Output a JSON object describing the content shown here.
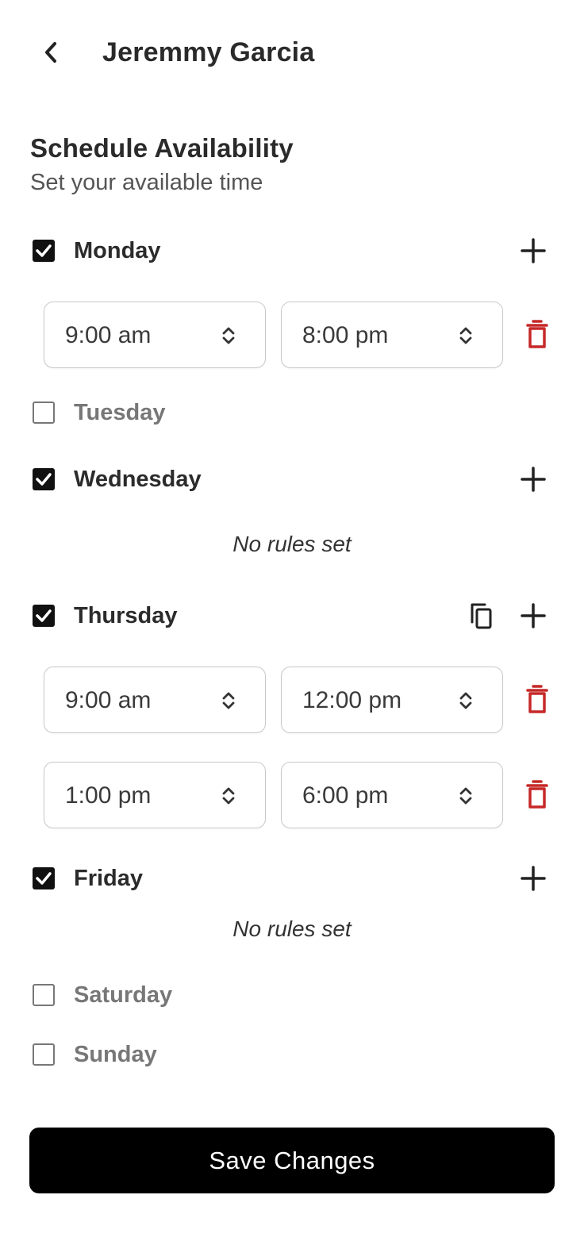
{
  "header": {
    "back_icon": "chevron-left-icon",
    "title": "Jeremmy Garcia"
  },
  "section": {
    "title": "Schedule Availability",
    "subtitle": "Set your available time"
  },
  "days": [
    {
      "label": "Monday",
      "checked": true,
      "slots": [
        {
          "start": "9:00 am",
          "end": "8:00 pm"
        }
      ]
    },
    {
      "label": "Tuesday",
      "checked": false,
      "slots": []
    },
    {
      "label": "Wednesday",
      "checked": true,
      "slots": [],
      "empty_text": "No rules set"
    },
    {
      "label": "Thursday",
      "checked": true,
      "slots": [
        {
          "start": "9:00 am",
          "end": "12:00 pm"
        },
        {
          "start": "1:00 pm",
          "end": "6:00 pm"
        }
      ]
    },
    {
      "label": "Friday",
      "checked": true,
      "slots": [],
      "empty_text": "No rules set"
    },
    {
      "label": "Saturday",
      "checked": false,
      "slots": []
    },
    {
      "label": "Sunday",
      "checked": false,
      "slots": []
    }
  ],
  "actions": {
    "save_label": "Save Changes"
  },
  "colors": {
    "accent": "#000000",
    "delete": "#c62828",
    "text": "#2b2b2b",
    "muted": "#777777"
  }
}
